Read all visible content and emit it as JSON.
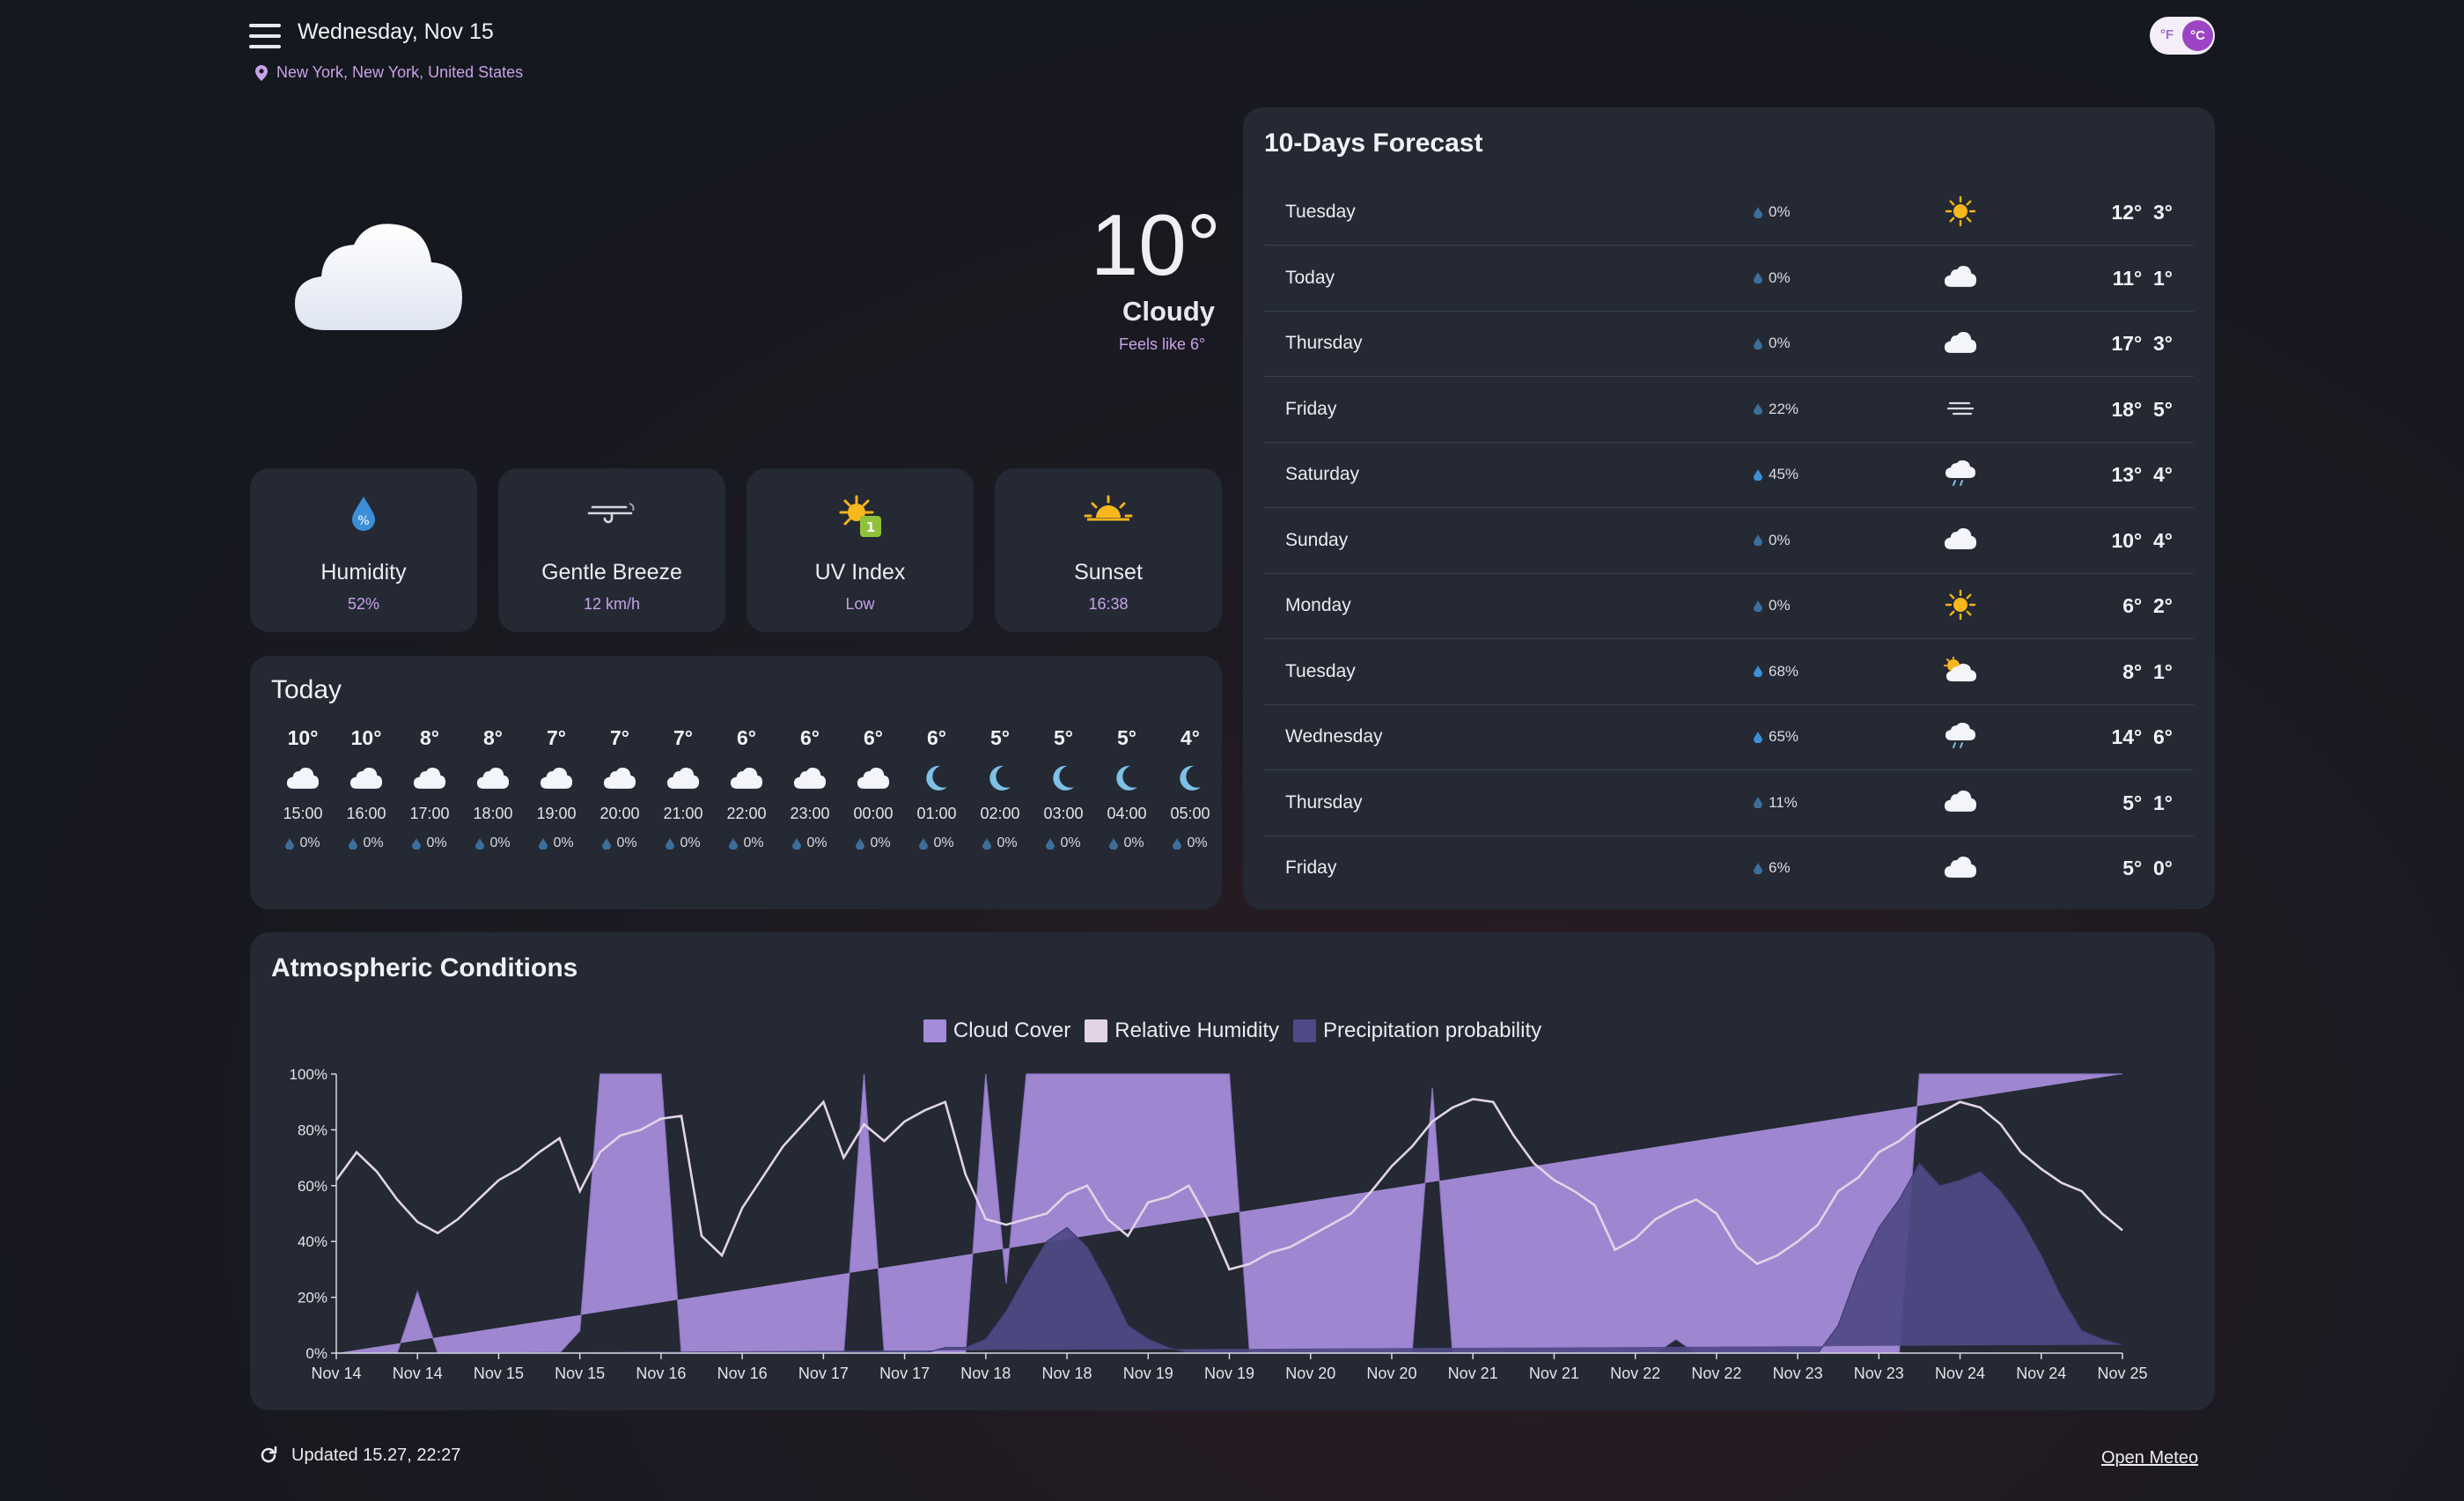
{
  "header": {
    "date": "Wednesday, Nov 15",
    "location": "New York, New York, United States",
    "unit_f": "°F",
    "unit_c": "°C",
    "unit_selected": "°C"
  },
  "current": {
    "temperature": "10°",
    "condition": "Cloudy",
    "feels_like": "Feels like 6°",
    "icon": "cloud-icon"
  },
  "stats": [
    {
      "title": "Humidity",
      "value": "52%",
      "icon": "humidity-drop-icon"
    },
    {
      "title": "Gentle Breeze",
      "value": "12 km/h",
      "icon": "wind-icon"
    },
    {
      "title": "UV Index",
      "value": "Low",
      "icon": "uv-sun-icon",
      "badge": "1"
    },
    {
      "title": "Sunset",
      "value": "16:38",
      "icon": "sunset-icon"
    }
  ],
  "today": {
    "title": "Today",
    "hours": [
      {
        "temp": "10°",
        "time": "15:00",
        "precip": "0%",
        "icon": "cloud"
      },
      {
        "temp": "10°",
        "time": "16:00",
        "precip": "0%",
        "icon": "cloud"
      },
      {
        "temp": "8°",
        "time": "17:00",
        "precip": "0%",
        "icon": "cloud"
      },
      {
        "temp": "8°",
        "time": "18:00",
        "precip": "0%",
        "icon": "cloud"
      },
      {
        "temp": "7°",
        "time": "19:00",
        "precip": "0%",
        "icon": "cloud"
      },
      {
        "temp": "7°",
        "time": "20:00",
        "precip": "0%",
        "icon": "cloud"
      },
      {
        "temp": "7°",
        "time": "21:00",
        "precip": "0%",
        "icon": "cloud"
      },
      {
        "temp": "6°",
        "time": "22:00",
        "precip": "0%",
        "icon": "cloud"
      },
      {
        "temp": "6°",
        "time": "23:00",
        "precip": "0%",
        "icon": "cloud"
      },
      {
        "temp": "6°",
        "time": "00:00",
        "precip": "0%",
        "icon": "cloud"
      },
      {
        "temp": "6°",
        "time": "01:00",
        "precip": "0%",
        "icon": "moon"
      },
      {
        "temp": "5°",
        "time": "02:00",
        "precip": "0%",
        "icon": "moon"
      },
      {
        "temp": "5°",
        "time": "03:00",
        "precip": "0%",
        "icon": "moon"
      },
      {
        "temp": "5°",
        "time": "04:00",
        "precip": "0%",
        "icon": "moon"
      },
      {
        "temp": "4°",
        "time": "05:00",
        "precip": "0%",
        "icon": "moon"
      }
    ]
  },
  "forecast": {
    "title": "10-Days Forecast",
    "days": [
      {
        "day": "Tuesday",
        "precip": "0%",
        "icon": "sun",
        "high": "12°",
        "low": "3°"
      },
      {
        "day": "Today",
        "precip": "0%",
        "icon": "cloud",
        "high": "11°",
        "low": "1°"
      },
      {
        "day": "Thursday",
        "precip": "0%",
        "icon": "cloud",
        "high": "17°",
        "low": "3°"
      },
      {
        "day": "Friday",
        "precip": "22%",
        "icon": "fog",
        "high": "18°",
        "low": "5°"
      },
      {
        "day": "Saturday",
        "precip": "45%",
        "icon": "rain-cloud",
        "high": "13°",
        "low": "4°"
      },
      {
        "day": "Sunday",
        "precip": "0%",
        "icon": "cloud",
        "high": "10°",
        "low": "4°"
      },
      {
        "day": "Monday",
        "precip": "0%",
        "icon": "sun",
        "high": "6°",
        "low": "2°"
      },
      {
        "day": "Tuesday",
        "precip": "68%",
        "icon": "sun-cloud",
        "high": "8°",
        "low": "1°"
      },
      {
        "day": "Wednesday",
        "precip": "65%",
        "icon": "rain-cloud",
        "high": "14°",
        "low": "6°"
      },
      {
        "day": "Thursday",
        "precip": "11%",
        "icon": "cloud",
        "high": "5°",
        "low": "1°"
      },
      {
        "day": "Friday",
        "precip": "6%",
        "icon": "cloud",
        "high": "5°",
        "low": "0°"
      }
    ]
  },
  "atmospheric": {
    "title": "Atmospheric Conditions"
  },
  "chart_data": {
    "type": "area",
    "title": "Atmospheric Conditions",
    "xlabel": "",
    "ylabel": "",
    "ylim": [
      0,
      100
    ],
    "y_ticks": [
      "0%",
      "20%",
      "40%",
      "60%",
      "80%",
      "100%"
    ],
    "x_ticks": [
      "Nov 14",
      "Nov 14",
      "Nov 15",
      "Nov 15",
      "Nov 16",
      "Nov 16",
      "Nov 17",
      "Nov 17",
      "Nov 18",
      "Nov 18",
      "Nov 19",
      "Nov 19",
      "Nov 20",
      "Nov 20",
      "Nov 21",
      "Nov 21",
      "Nov 22",
      "Nov 22",
      "Nov 23",
      "Nov 23",
      "Nov 24",
      "Nov 24",
      "Nov 25"
    ],
    "x": [
      0,
      3,
      6,
      9,
      12,
      15,
      18,
      21,
      24,
      27,
      30,
      33,
      36,
      39,
      42,
      45,
      48,
      51,
      54,
      57,
      60,
      63,
      66,
      69,
      72,
      75,
      78,
      81,
      84,
      87,
      90,
      93,
      96,
      99,
      102,
      105,
      108,
      111,
      114,
      117,
      120,
      123,
      126,
      129,
      132,
      135,
      138,
      141,
      144,
      147,
      150,
      153,
      156,
      159,
      162,
      165,
      168,
      171,
      174,
      177,
      180,
      183,
      186,
      189,
      192,
      195,
      198,
      201,
      204,
      207,
      210,
      213,
      216,
      219,
      222,
      225,
      228,
      231,
      234,
      237,
      240,
      243,
      246,
      249,
      252,
      255,
      258,
      261,
      264
    ],
    "x_unit": "hours",
    "legend_position": "top-center",
    "grid": false,
    "series": [
      {
        "name": "Cloud Cover",
        "color": "#a68bd9",
        "values": [
          0,
          0,
          0,
          0,
          22,
          0,
          0,
          0,
          0,
          0,
          0,
          0,
          8,
          100,
          100,
          100,
          100,
          0,
          0,
          0,
          0,
          0,
          0,
          0,
          0,
          0,
          100,
          0,
          0,
          0,
          0,
          0,
          100,
          25,
          100,
          100,
          100,
          100,
          100,
          100,
          100,
          100,
          100,
          100,
          100,
          0,
          0,
          0,
          0,
          0,
          0,
          0,
          0,
          0,
          95,
          0,
          0,
          0,
          0,
          0,
          0,
          0,
          0,
          0,
          0,
          0,
          5,
          0,
          0,
          0,
          0,
          0,
          0,
          0,
          0,
          0,
          0,
          0,
          100,
          100,
          100,
          100,
          100,
          100,
          100,
          100,
          100,
          100,
          100,
          100,
          100,
          100,
          100,
          100,
          100,
          100,
          100,
          100,
          100,
          100,
          100,
          0,
          0
        ]
      },
      {
        "name": "Relative Humidity",
        "color": "#e2d4e6",
        "values": [
          62,
          72,
          65,
          55,
          47,
          43,
          48,
          55,
          62,
          66,
          72,
          77,
          58,
          72,
          78,
          80,
          84,
          85,
          42,
          35,
          52,
          63,
          74,
          82,
          90,
          70,
          82,
          76,
          83,
          87,
          90,
          64,
          48,
          46,
          48,
          50,
          57,
          60,
          48,
          42,
          54,
          56,
          60,
          47,
          30,
          32,
          36,
          38,
          42,
          46,
          50,
          58,
          67,
          74,
          83,
          88,
          91,
          90,
          78,
          68,
          62,
          58,
          53,
          37,
          41,
          48,
          52,
          55,
          50,
          38,
          32,
          35,
          40,
          46,
          58,
          63,
          72,
          76,
          82,
          86,
          90,
          88,
          82,
          72,
          66,
          61,
          58,
          50,
          44,
          46,
          49,
          53,
          56,
          49,
          38,
          33,
          38,
          43,
          48,
          47,
          47,
          47,
          47
        ]
      },
      {
        "name": "Precipitation probability",
        "color": "#4f4a86",
        "values": [
          0,
          0,
          0,
          0,
          0,
          0,
          0,
          0,
          0,
          0,
          0,
          0,
          0,
          0,
          0,
          0,
          0,
          0,
          0,
          0,
          0,
          0,
          0,
          0,
          0,
          0,
          0,
          0,
          0,
          0,
          2,
          2,
          5,
          15,
          28,
          40,
          45,
          38,
          25,
          10,
          5,
          2,
          0,
          0,
          0,
          0,
          0,
          0,
          0,
          0,
          0,
          0,
          0,
          0,
          0,
          0,
          0,
          0,
          0,
          0,
          0,
          0,
          0,
          0,
          0,
          0,
          0,
          0,
          0,
          0,
          0,
          0,
          0,
          0,
          10,
          30,
          45,
          55,
          68,
          60,
          62,
          65,
          58,
          48,
          35,
          20,
          8,
          5,
          3,
          2,
          0,
          2,
          3,
          3,
          3,
          3,
          3,
          5,
          3,
          3,
          3,
          3,
          3
        ]
      }
    ]
  },
  "footer": {
    "updated": "Updated 15.27, 22:27",
    "link": "Open Meteo"
  }
}
